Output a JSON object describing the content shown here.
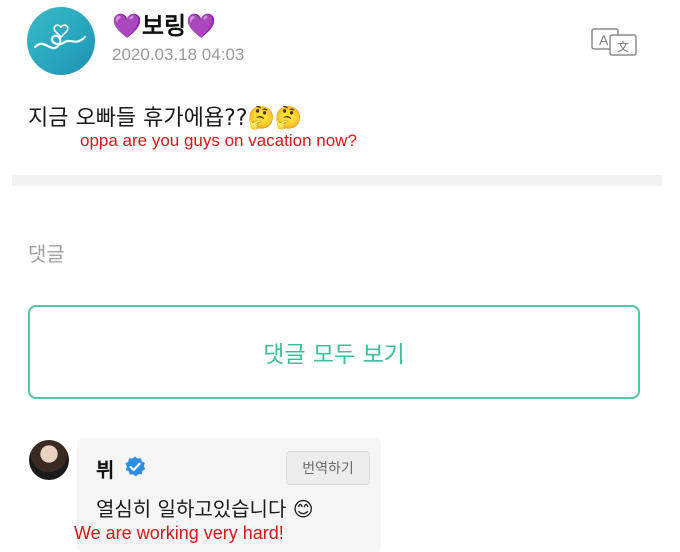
{
  "post": {
    "author": "💜보링💜",
    "timestamp": "2020.03.18 04:03",
    "body": "지금 오빠들 휴가에욥??🤔🤔",
    "translation_caption": "oppa are you guys on vacation now?",
    "translate_icon": "translate-icon"
  },
  "comments": {
    "heading": "댓글",
    "view_all_label": "댓글 모두 보기",
    "items": [
      {
        "author": "뷔",
        "verified": true,
        "translate_label": "번역하기",
        "text": "열심히 일하고있습니다 😊",
        "translation_caption": "We are working very hard!"
      }
    ]
  },
  "colors": {
    "accent": "#3cbf9c",
    "caption": "#d41a1a",
    "verified": "#2d8ee8"
  }
}
